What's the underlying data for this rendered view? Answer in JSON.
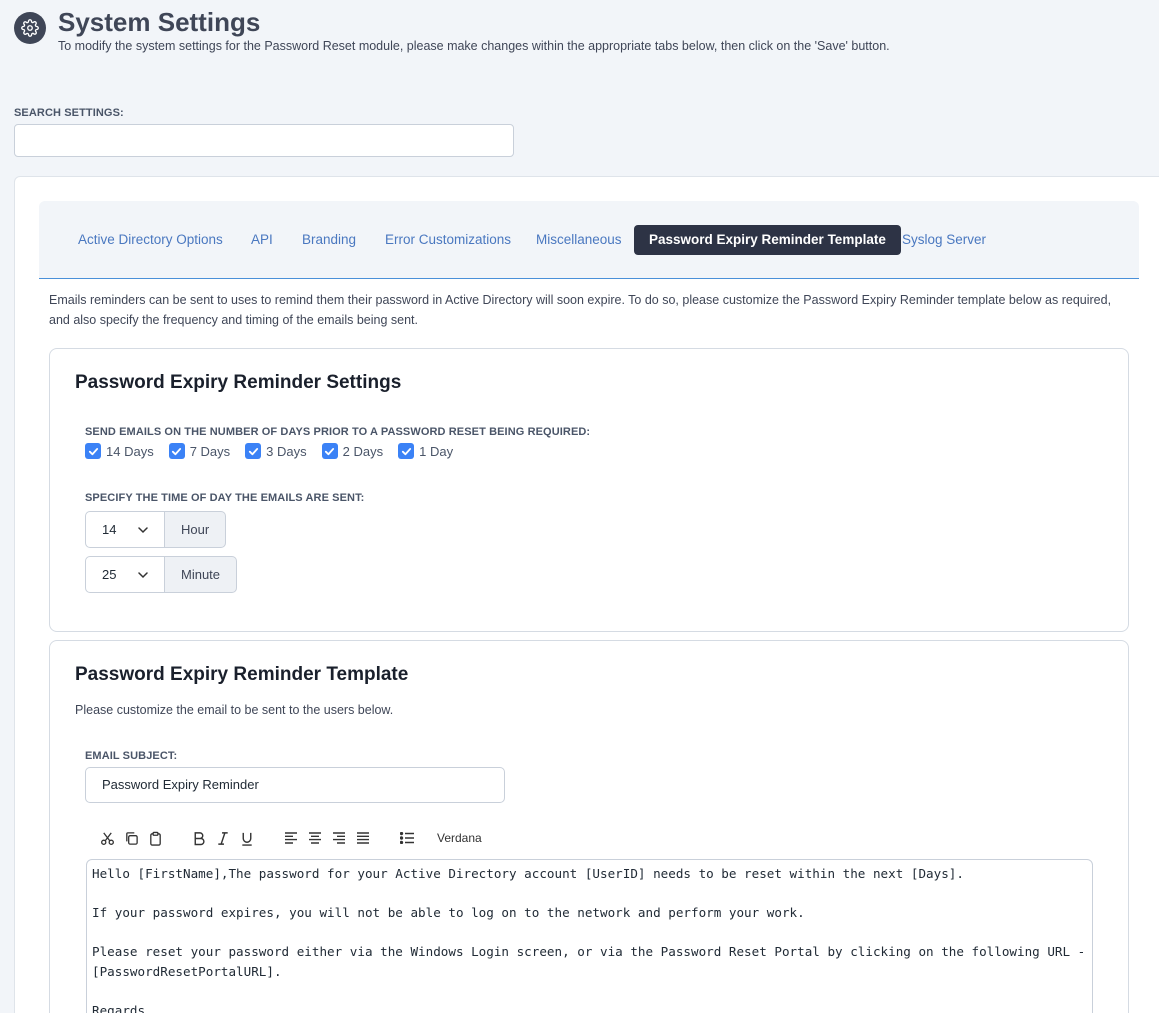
{
  "header": {
    "title": "System Settings",
    "subtitle": "To modify the system settings for the Password Reset module, please make changes within the appropriate tabs below, then click on the 'Save' button.",
    "icon": "gear-icon"
  },
  "search": {
    "label": "SEARCH SETTINGS:",
    "value": "",
    "placeholder": ""
  },
  "tabs": [
    {
      "label": "Active Directory Options",
      "active": false
    },
    {
      "label": "API",
      "active": false
    },
    {
      "label": "Branding",
      "active": false
    },
    {
      "label": "Error Customizations",
      "active": false
    },
    {
      "label": "Miscellaneous",
      "active": false
    },
    {
      "label": "Password Expiry Reminder Template",
      "active": true
    },
    {
      "label": "Syslog Server",
      "active": false
    }
  ],
  "intro": "Emails reminders can be sent to uses to remind them their password in Active Directory will soon expire. To do so, please customize the Password Expiry Reminder template below as required, and also specify the frequency and timing of the emails being sent.",
  "settings_card": {
    "title": "Password Expiry Reminder Settings",
    "days_label": "SEND EMAILS ON THE NUMBER OF DAYS PRIOR TO A PASSWORD RESET BEING REQUIRED:",
    "days": [
      {
        "label": "14 Days",
        "checked": true
      },
      {
        "label": "7 Days",
        "checked": true
      },
      {
        "label": "3 Days",
        "checked": true
      },
      {
        "label": "2 Days",
        "checked": true
      },
      {
        "label": "1 Day",
        "checked": true
      }
    ],
    "time_label": "SPECIFY THE TIME OF DAY THE EMAILS ARE SENT:",
    "hour_value": "14",
    "hour_addon": "Hour",
    "minute_value": "25",
    "minute_addon": "Minute"
  },
  "template_card": {
    "title": "Password Expiry Reminder Template",
    "description": "Please customize the email to be sent to the users below.",
    "subject_label": "EMAIL SUBJECT:",
    "subject_value": "Password Expiry Reminder",
    "toolbar": {
      "font": "Verdana",
      "icons": [
        "cut-icon",
        "copy-icon",
        "paste-icon",
        "bold-icon",
        "italic-icon",
        "underline-icon",
        "align-left-icon",
        "align-center-icon",
        "align-right-icon",
        "align-justify-icon",
        "bullet-list-icon"
      ]
    },
    "body": {
      "line1": "Hello [FirstName],The password for your Active Directory account [UserID] needs to be reset within the next [Days].",
      "line2": "If your password expires, you will not be able to log on to the network and perform your work.",
      "line3a": "Please reset your password either via the Windows Login screen, or via the Password Reset Portal by clicking on the following URL -",
      "line3b": "[PasswordResetPortalURL].",
      "line4": "Regards"
    }
  },
  "colors": {
    "accent": "#3b82f6",
    "active_tab": "#2d3345",
    "tab_link": "#4a78c0",
    "page_bg": "#f2f5f9"
  }
}
